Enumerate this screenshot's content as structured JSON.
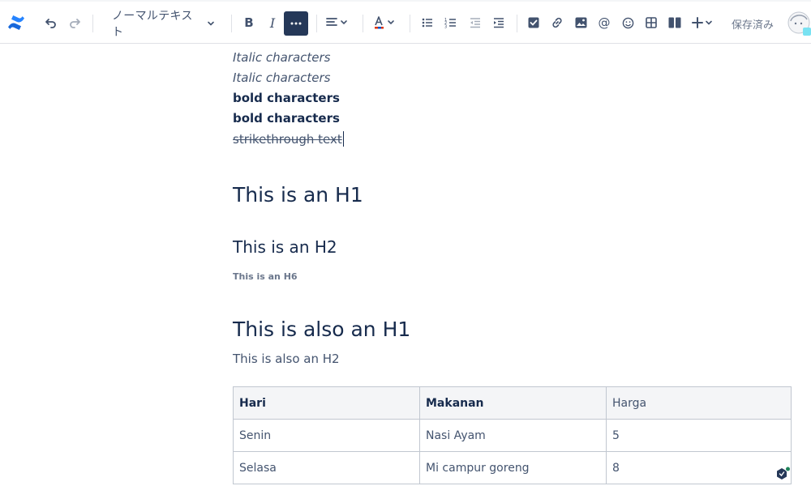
{
  "toolbar": {
    "text_style": "ノーマルテキスト",
    "saved_label": "保存済み",
    "icons": [
      "confluence-logo",
      "undo",
      "redo",
      "bold",
      "italic",
      "more",
      "align",
      "text-color",
      "bullet-list",
      "numbered-list",
      "outdent",
      "indent",
      "task",
      "link",
      "image",
      "mention",
      "emoji",
      "table",
      "layouts",
      "insert"
    ]
  },
  "content": {
    "italic_1": "Italic characters",
    "italic_2": "Italic characters",
    "bold_1": "bold characters",
    "bold_2": "bold characters",
    "strike": "strikethrough text",
    "h1": "This is an H1",
    "h2": "This is an H2",
    "h6": "This is an H6",
    "h1_b": "This is also an H1",
    "p_b": "This is also an H2"
  },
  "table": {
    "headers": [
      "Hari",
      "Makanan",
      "Harga"
    ],
    "rows": [
      [
        "Senin",
        "Nasi Ayam",
        "5"
      ],
      [
        "Selasa",
        "Mi campur goreng",
        "8"
      ]
    ]
  },
  "colors": {
    "accent": "#0052cc",
    "more_button_bg": "#253858",
    "text": "#172b4d",
    "text_color_underline": "#de350b"
  }
}
